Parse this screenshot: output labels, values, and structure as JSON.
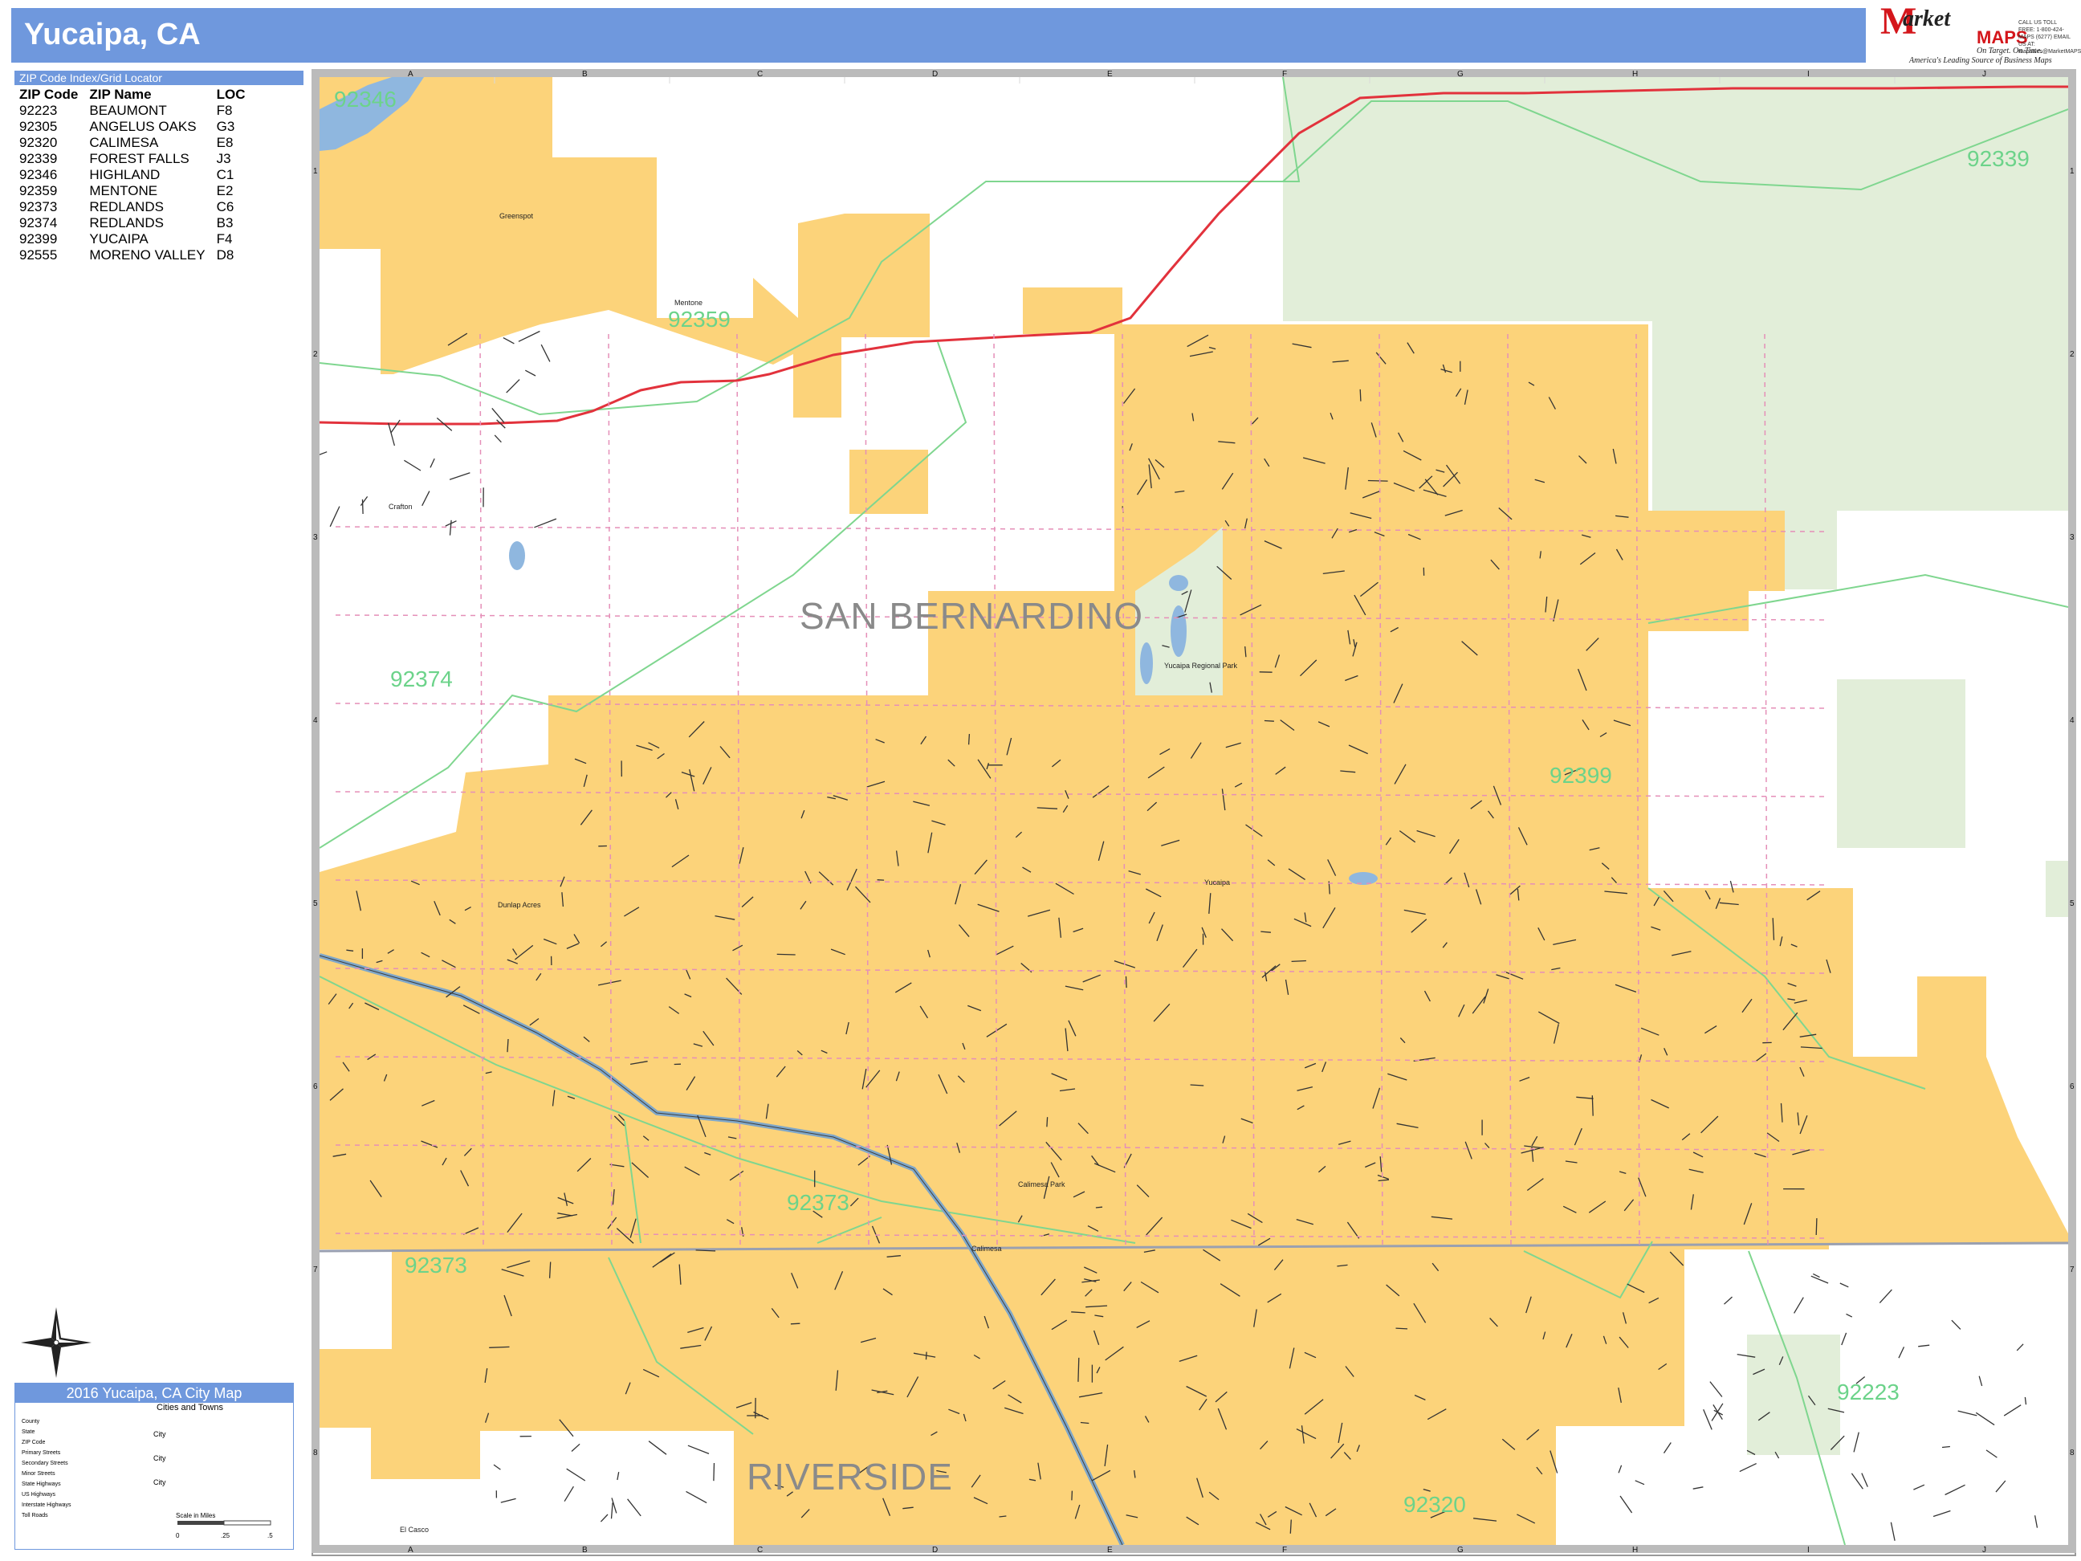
{
  "header": {
    "title": "Yucaipa, CA"
  },
  "logo": {
    "brand_prefix": "M",
    "brand_main": "arket",
    "brand_suffix": "MAPS",
    "tagline": "On Target. On Time.",
    "tagline2": "America's Leading Source of Business Maps",
    "contact": "CALL US TOLL FREE: 1-800-424-MAPS (6277) EMAIL US AT: mapsales@MarketMAPS.com"
  },
  "zip_index": {
    "bar_title": "ZIP Code Index/Grid Locator",
    "headers": [
      "ZIP Code",
      "ZIP Name",
      "LOC"
    ],
    "rows": [
      [
        "92223",
        "BEAUMONT",
        "F8"
      ],
      [
        "92305",
        "ANGELUS OAKS",
        "G3"
      ],
      [
        "92320",
        "CALIMESA",
        "E8"
      ],
      [
        "92339",
        "FOREST FALLS",
        "J3"
      ],
      [
        "92346",
        "HIGHLAND",
        "C1"
      ],
      [
        "92359",
        "MENTONE",
        "E2"
      ],
      [
        "92373",
        "REDLANDS",
        "C6"
      ],
      [
        "92374",
        "REDLANDS",
        "B3"
      ],
      [
        "92399",
        "YUCAIPA",
        "F4"
      ],
      [
        "92555",
        "MORENO VALLEY",
        "D8"
      ]
    ]
  },
  "grid": {
    "columns": [
      "A",
      "B",
      "C",
      "D",
      "E",
      "F",
      "G",
      "H",
      "I",
      "J"
    ],
    "rows": [
      "1",
      "2",
      "3",
      "4",
      "5",
      "6",
      "7",
      "8"
    ]
  },
  "map_labels": {
    "zips": [
      {
        "text": "92346"
      },
      {
        "text": "92359"
      },
      {
        "text": "92339"
      },
      {
        "text": "92374"
      },
      {
        "text": "92399"
      },
      {
        "text": "92373"
      },
      {
        "text": "92373"
      },
      {
        "text": "92223"
      },
      {
        "text": "92320"
      }
    ],
    "counties": [
      {
        "text": "SAN BERNARDINO"
      },
      {
        "text": "RIVERSIDE"
      }
    ],
    "places": [
      {
        "text": "Greenspot"
      },
      {
        "text": "Mentone"
      },
      {
        "text": "Crafton"
      },
      {
        "text": "Dunlap Acres"
      },
      {
        "text": "Yucaipa"
      },
      {
        "text": "Calimesa"
      },
      {
        "text": "El Casco"
      },
      {
        "text": "Yucaipa Regional Park"
      },
      {
        "text": "Calimesa Park"
      }
    ]
  },
  "legend": {
    "title": "2016 Yucaipa, CA City Map",
    "subtitle": "Cities and Towns",
    "items": [
      "County",
      "State",
      "ZIP Code",
      "Primary Streets",
      "Secondary Streets",
      "Minor Streets",
      "State Highways",
      "US Highways",
      "Interstate Highways",
      "Toll Roads"
    ],
    "city_marker": "City",
    "scale_title": "Scale in Miles",
    "scale_ticks": [
      "0",
      ".25",
      ".5"
    ]
  },
  "colors": {
    "header": "#6f98dd",
    "city_fill": "#fcd37a",
    "forest_fill": "#e2eed9",
    "zip_label": "#6cd38a",
    "zip_boundary": "#7fd68f",
    "state_highway": "#e2323c",
    "interstate": "#7fa7c9",
    "water": "#8fb7df"
  }
}
